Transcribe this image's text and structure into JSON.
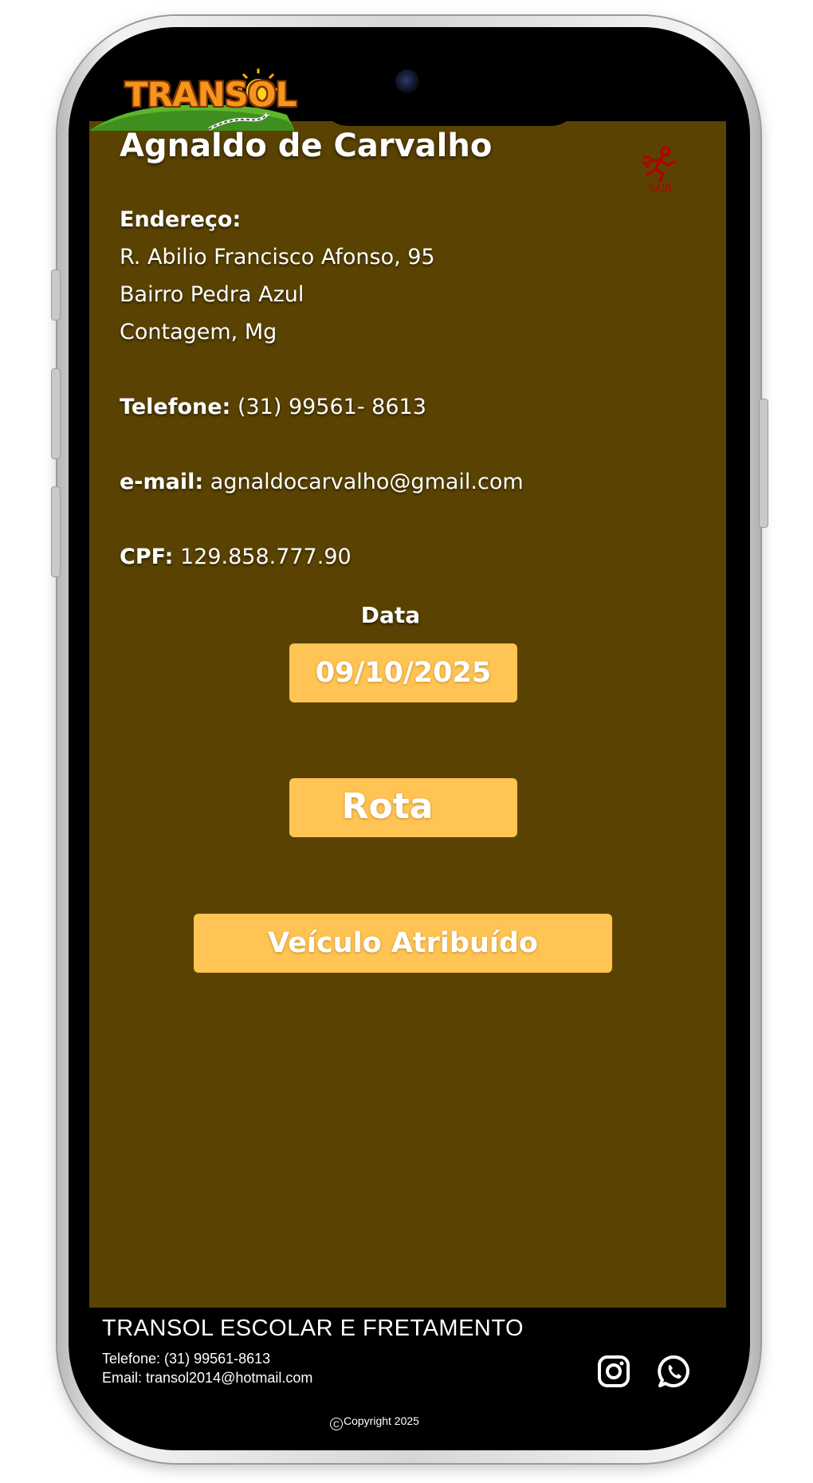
{
  "app": {
    "brand": "TRANSOL"
  },
  "profile": {
    "name": "Agnaldo de Carvalho",
    "address_label": "Endereço:",
    "address_line1": "R. Abilio Francisco Afonso, 95",
    "address_line2": "Bairro Pedra Azul",
    "address_line3": "Contagem, Mg",
    "phone_label": "Telefone:",
    "phone_value": "(31) 99561- 8613",
    "email_label": "e-mail:",
    "email_value": "agnaldocarvalho@gmail.com",
    "cpf_label": "CPF:",
    "cpf_value": "129.858.777.90"
  },
  "logout": {
    "label": "SAIR",
    "icon": "running-person-icon",
    "color": "#b30000"
  },
  "date": {
    "label": "Data",
    "value": "09/10/2025"
  },
  "buttons": {
    "route_label": "Rota",
    "vehicle_label": "Veículo Atribuído"
  },
  "footer": {
    "title": "TRANSOL ESCOLAR E FRETAMENTO",
    "phone": "Telefone: (31) 99561-8613",
    "email": "Email: transol2014@hotmail.com",
    "copyright": "Copyright 2025",
    "social_icons": [
      "instagram-icon",
      "whatsapp-icon"
    ]
  },
  "colors": {
    "panel_bg": "#5a4302",
    "button_bg": "#ffc453",
    "logo_orange": "#f7941d",
    "logo_green": "#5fb52b"
  }
}
